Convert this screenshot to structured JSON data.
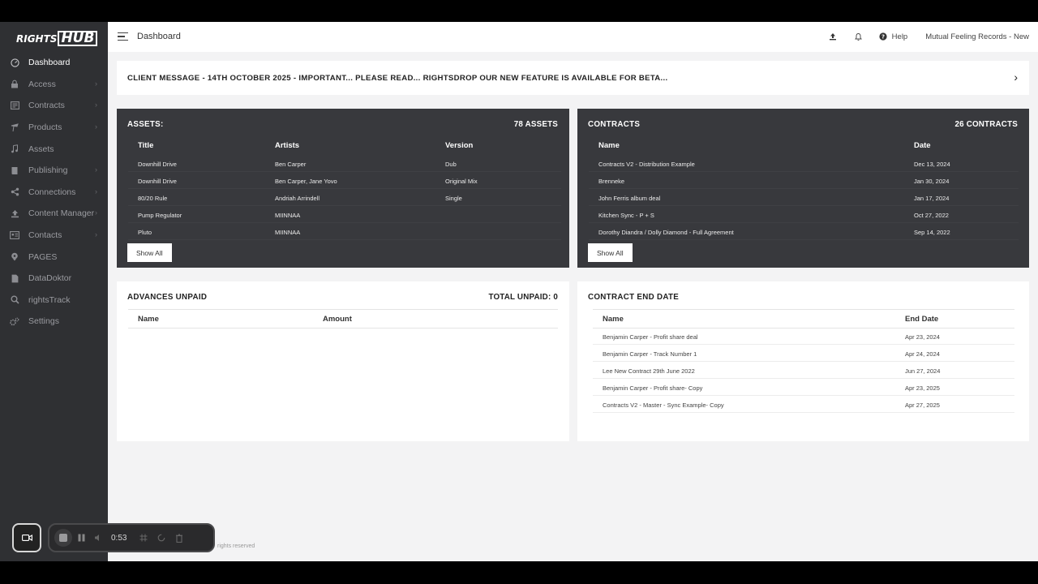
{
  "brand": {
    "logo_part1": "RIGHTS",
    "logo_part2": "HUB"
  },
  "sidebar": {
    "items": [
      {
        "label": "Dashboard",
        "icon": "dashboard-icon",
        "has_submenu": false,
        "active": true
      },
      {
        "label": "Access",
        "icon": "lock-icon",
        "has_submenu": true
      },
      {
        "label": "Contracts",
        "icon": "contracts-icon",
        "has_submenu": true
      },
      {
        "label": "Products",
        "icon": "products-icon",
        "has_submenu": true
      },
      {
        "label": "Assets",
        "icon": "music-note-icon",
        "has_submenu": false
      },
      {
        "label": "Publishing",
        "icon": "book-icon",
        "has_submenu": true
      },
      {
        "label": "Connections",
        "icon": "share-icon",
        "has_submenu": true
      },
      {
        "label": "Content Manager",
        "icon": "upload-icon",
        "has_submenu": true
      },
      {
        "label": "Contacts",
        "icon": "contact-card-icon",
        "has_submenu": true
      },
      {
        "label": "PAGES",
        "icon": "pin-icon",
        "has_submenu": false
      },
      {
        "label": "DataDoktor",
        "icon": "document-icon",
        "has_submenu": false
      },
      {
        "label": "rightsTrack",
        "icon": "search-icon",
        "has_submenu": false
      },
      {
        "label": "Settings",
        "icon": "cogs-icon",
        "has_submenu": false
      }
    ]
  },
  "topbar": {
    "title": "Dashboard",
    "help_label": "Help",
    "account_name": "Mutual Feeling Records - New"
  },
  "banner": {
    "message": "CLIENT MESSAGE - 14TH OCTOBER 2025 - IMPORTANT... PLEASE READ... RIGHTSDROP OUR NEW FEATURE IS AVAILABLE FOR BETA..."
  },
  "assets": {
    "title": "ASSETS:",
    "count": "78 ASSETS",
    "columns": [
      "Title",
      "Artists",
      "Version"
    ],
    "rows": [
      [
        "Downhill Drive",
        "Ben Carper",
        "Dub"
      ],
      [
        "Downhill Drive",
        "Ben Carper, Jane Yovo",
        "Original Mix"
      ],
      [
        "80/20 Rule",
        "Andriah Arrindell",
        "Single"
      ],
      [
        "Pump Regulator",
        "MIINNAA",
        ""
      ],
      [
        "Pluto",
        "MIINNAA",
        ""
      ]
    ],
    "show_all": "Show All"
  },
  "contracts": {
    "title": "CONTRACTS",
    "count": "26 CONTRACTS",
    "columns": [
      "Name",
      "Date"
    ],
    "rows": [
      [
        "Contracts V2 - Distribution Example",
        "Dec 13, 2024"
      ],
      [
        "Brenneke",
        "Jan 30, 2024"
      ],
      [
        "John Ferris album deal",
        "Jan 17, 2024"
      ],
      [
        "Kitchen Sync - P + S",
        "Oct 27, 2022"
      ],
      [
        "Dorothy Diandra / Dolly Diamond - Full Agreement",
        "Sep 14, 2022"
      ]
    ],
    "show_all": "Show All"
  },
  "advances": {
    "title": "ADVANCES UNPAID",
    "total": "TOTAL UNPAID: 0",
    "columns": [
      "Name",
      "Amount"
    ]
  },
  "contract_end": {
    "title": "CONTRACT END DATE",
    "columns": [
      "Name",
      "End Date"
    ],
    "rows": [
      [
        "Benjamin Carper - Profit share deal",
        "Apr 23, 2024"
      ],
      [
        "Benjamin Carper - Track Number 1",
        "Apr 24, 2024"
      ],
      [
        "Lee New Contract 29th June 2022",
        "Jun 27, 2024"
      ],
      [
        "Benjamin Carper - Profit share- Copy",
        "Apr 23, 2025"
      ],
      [
        "Contracts V2 - Master - Sync Example- Copy",
        "Apr 27, 2025"
      ]
    ]
  },
  "footer": {
    "copyright": "rights reserved"
  },
  "recorder": {
    "time": "0:53"
  }
}
